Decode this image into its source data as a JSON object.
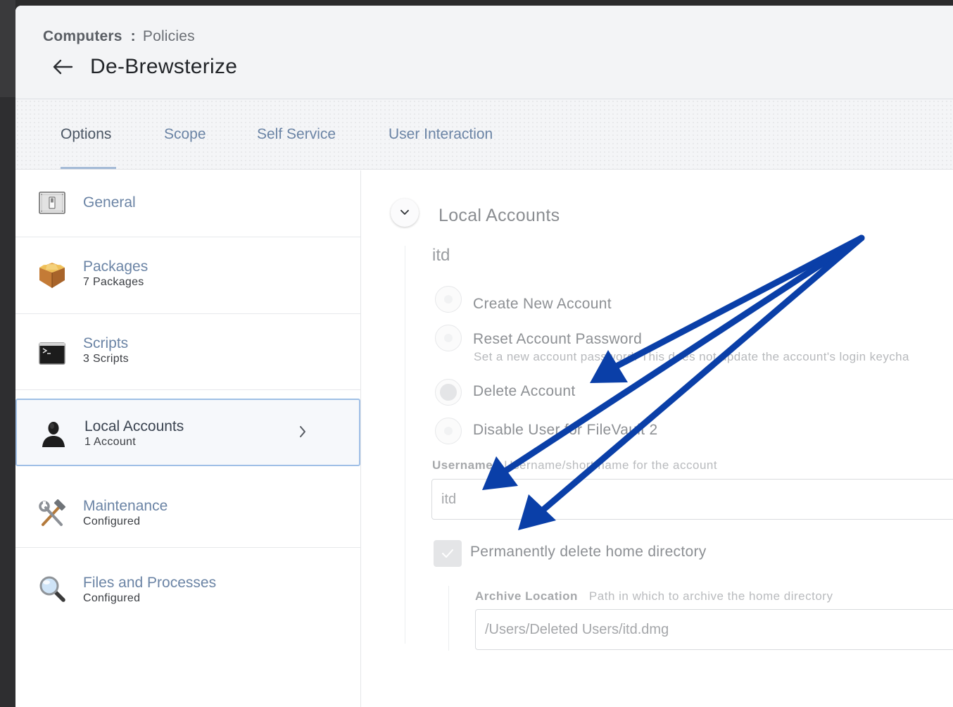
{
  "breadcrumb": {
    "section": "Computers",
    "separator": ":",
    "page": "Policies"
  },
  "page_title": "De-Brewsterize",
  "tabs": [
    {
      "label": "Options"
    },
    {
      "label": "Scope"
    },
    {
      "label": "Self Service"
    },
    {
      "label": "User Interaction"
    }
  ],
  "sidebar": {
    "items": [
      {
        "label": "General",
        "sub": "",
        "icon": "switch-icon"
      },
      {
        "label": "Packages",
        "sub": "7 Packages",
        "icon": "package-box-icon"
      },
      {
        "label": "Scripts",
        "sub": "3 Scripts",
        "icon": "terminal-icon"
      },
      {
        "label": "Local Accounts",
        "sub": "1 Account",
        "icon": "user-silhouette-icon"
      },
      {
        "label": "Maintenance",
        "sub": "Configured",
        "icon": "hammer-wrench-icon"
      },
      {
        "label": "Files and Processes",
        "sub": "Configured",
        "icon": "magnifier-icon"
      }
    ]
  },
  "main": {
    "section_title": "Local Accounts",
    "account_name": "itd",
    "options": [
      {
        "label": "Create New Account",
        "selected": false
      },
      {
        "label": "Reset Account Password",
        "selected": false,
        "description": "Set a new account password. This does not update the account's login keycha"
      },
      {
        "label": "Delete Account",
        "selected": true
      },
      {
        "label": "Disable User for FileVault 2",
        "selected": false
      }
    ],
    "username": {
      "label": "Username",
      "hint": "Username/short name for the account",
      "value": "itd"
    },
    "delete_home": {
      "label": "Permanently delete home directory",
      "checked": true
    },
    "archive": {
      "label": "Archive Location",
      "hint": "Path in which to archive the home directory",
      "value": "/Users/Deleted Users/itd.dmg"
    }
  },
  "colors": {
    "annotation_arrow": "#0a3fa8",
    "link_blue": "#6b84a5",
    "selected_border": "#9fbfe6"
  }
}
